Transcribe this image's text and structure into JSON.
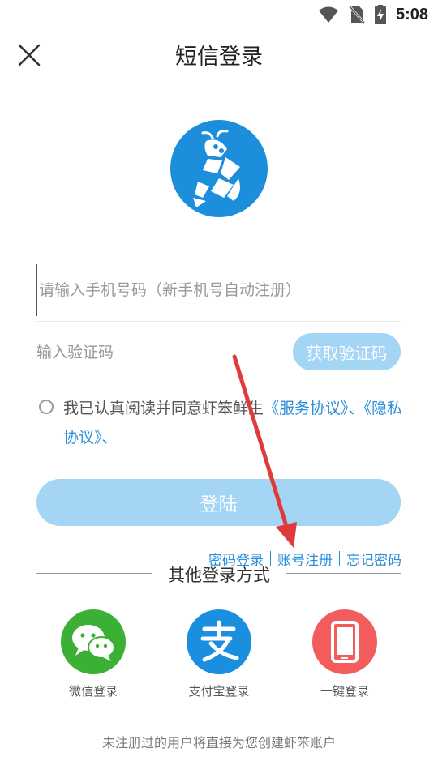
{
  "status_bar": {
    "time": "5:08",
    "wifi_icon": "wifi-icon",
    "no_sim_icon": "no-sim-icon",
    "battery_icon": "battery-charging-icon"
  },
  "header": {
    "title": "短信登录",
    "close_icon": "close-icon"
  },
  "logo": {
    "icon": "shrimp-logo-icon",
    "color": "#1c8edb"
  },
  "form": {
    "phone_placeholder": "请输入手机号码（新手机号自动注册）",
    "phone_value": "",
    "code_placeholder": "输入验证码",
    "code_value": "",
    "get_code_label": "获取验证码"
  },
  "agreement": {
    "prefix": "我已认真阅读并同意虾笨鲜生",
    "service_link": "《服务协议》",
    "separator": "、",
    "privacy_link": "《隐私协议》",
    "suffix": "、",
    "checked": false
  },
  "login_button": {
    "label": "登陆"
  },
  "links": {
    "password_login": "密码登录",
    "register": "账号注册",
    "forgot_password": "忘记密码"
  },
  "other_login": {
    "title": "其他登录方式",
    "options": [
      {
        "label": "微信登录",
        "icon": "wechat-icon",
        "color": "#3cb034"
      },
      {
        "label": "支付宝登录",
        "icon": "alipay-icon",
        "color": "#1a8fe0"
      },
      {
        "label": "一键登录",
        "icon": "phone-icon",
        "color": "#f25c5c"
      }
    ]
  },
  "footer": {
    "note": "未注册过的用户将直接为您创建虾笨账户"
  },
  "colors": {
    "accent": "#2a8fd8",
    "button_disabled": "#a4d5f4",
    "annotation_arrow": "#e23a3a"
  }
}
